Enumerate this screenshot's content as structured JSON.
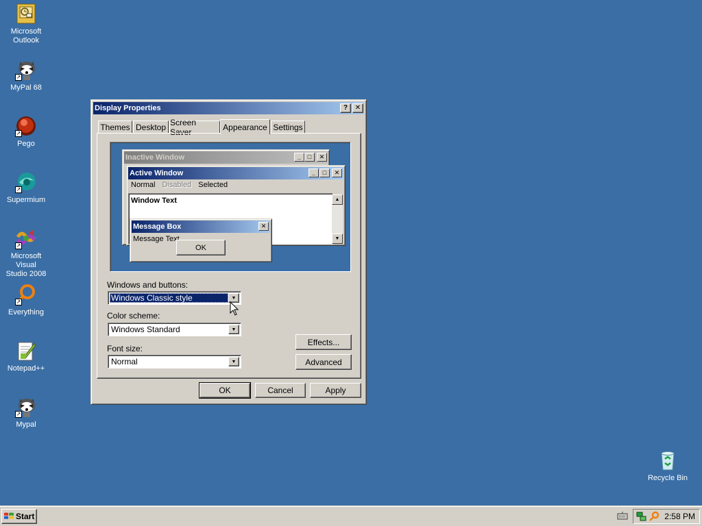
{
  "desktop": {
    "background_color": "#3a6ea5",
    "icons": [
      {
        "label_line1": "Microsoft",
        "label_line2": "Outlook",
        "icon": "outlook-icon"
      },
      {
        "label_line1": "MyPal 68",
        "label_line2": "",
        "icon": "mypal-icon"
      },
      {
        "label_line1": "Pego",
        "label_line2": "",
        "icon": "pego-icon"
      },
      {
        "label_line1": "Supermium",
        "label_line2": "",
        "icon": "supermium-icon"
      },
      {
        "label_line1": "Microsoft Visual",
        "label_line2": "Studio 2008",
        "icon": "visual-studio-icon"
      },
      {
        "label_line1": "Everything",
        "label_line2": "",
        "icon": "everything-icon"
      },
      {
        "label_line1": "Notepad++",
        "label_line2": "",
        "icon": "notepadpp-icon"
      },
      {
        "label_line1": "Mypal",
        "label_line2": "",
        "icon": "mypal-icon"
      }
    ],
    "recycle_bin": {
      "label": "Recycle Bin",
      "icon": "recycle-bin-icon"
    }
  },
  "dialog": {
    "title": "Display Properties",
    "help_glyph": "?",
    "close_glyph": "✕",
    "tabs": [
      "Themes",
      "Desktop",
      "Screen Saver",
      "Appearance",
      "Settings"
    ],
    "active_tab": "Appearance",
    "preview": {
      "inactive_title": "Inactive Window",
      "active_title": "Active Window",
      "menu_normal": "Normal",
      "menu_disabled": "Disabled",
      "menu_selected": "Selected",
      "window_text": "Window Text",
      "message_box_title": "Message Box",
      "message_text": "Message Text",
      "ok_label": "OK"
    },
    "windows_and_buttons": {
      "label": "Windows and buttons:",
      "value": "Windows Classic style"
    },
    "color_scheme": {
      "label": "Color scheme:",
      "value": "Windows Standard"
    },
    "font_size": {
      "label": "Font size:",
      "value": "Normal"
    },
    "effects_label": "Effects...",
    "advanced_label": "Advanced",
    "ok_label": "OK",
    "cancel_label": "Cancel",
    "apply_label": "Apply"
  },
  "taskbar": {
    "start_label": "Start",
    "clock": "2:58 PM"
  },
  "colors": {
    "active_title_start": "#0a246a",
    "active_title_end": "#a6caf0",
    "face": "#d4d0c8"
  }
}
